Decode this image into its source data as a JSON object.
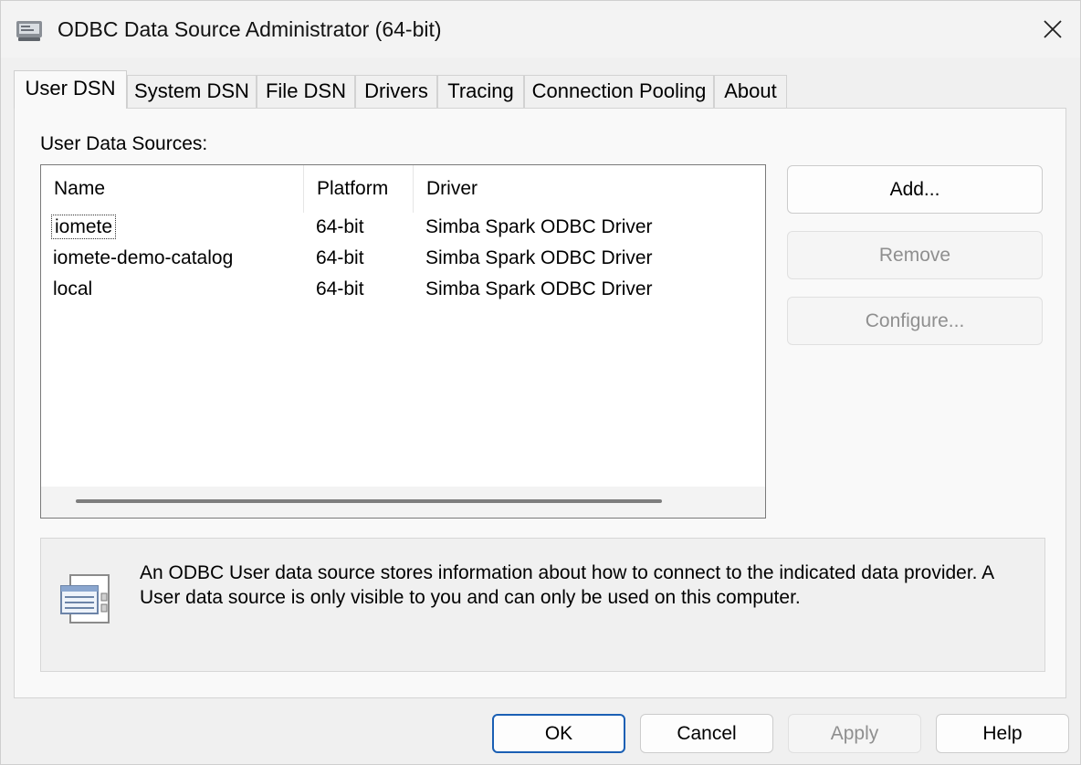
{
  "window": {
    "title": "ODBC Data Source Administrator (64-bit)",
    "app_icon": "odbc-admin-icon",
    "close_icon": "close-icon"
  },
  "tabs": [
    {
      "label": "User DSN",
      "active": true
    },
    {
      "label": "System DSN"
    },
    {
      "label": "File DSN"
    },
    {
      "label": "Drivers"
    },
    {
      "label": "Tracing"
    },
    {
      "label": "Connection Pooling"
    },
    {
      "label": "About"
    }
  ],
  "panel": {
    "section_label": "User Data Sources:",
    "columns": [
      "Name",
      "Platform",
      "Driver"
    ],
    "rows": [
      {
        "name": "iomete",
        "platform": "64-bit",
        "driver": "Simba Spark ODBC Driver"
      },
      {
        "name": "iomete-demo-catalog",
        "platform": "64-bit",
        "driver": "Simba Spark ODBC Driver"
      },
      {
        "name": "local",
        "platform": "64-bit",
        "driver": "Simba Spark ODBC Driver"
      }
    ],
    "buttons": {
      "add": "Add...",
      "remove": "Remove",
      "configure": "Configure..."
    },
    "info": {
      "icon": "datasource-info-icon",
      "text": "An ODBC User data source stores information about how to connect to the indicated data provider.   A User data source is only visible to you and can only be used on this computer."
    }
  },
  "footer": {
    "ok": "OK",
    "cancel": "Cancel",
    "apply": "Apply",
    "help": "Help"
  }
}
